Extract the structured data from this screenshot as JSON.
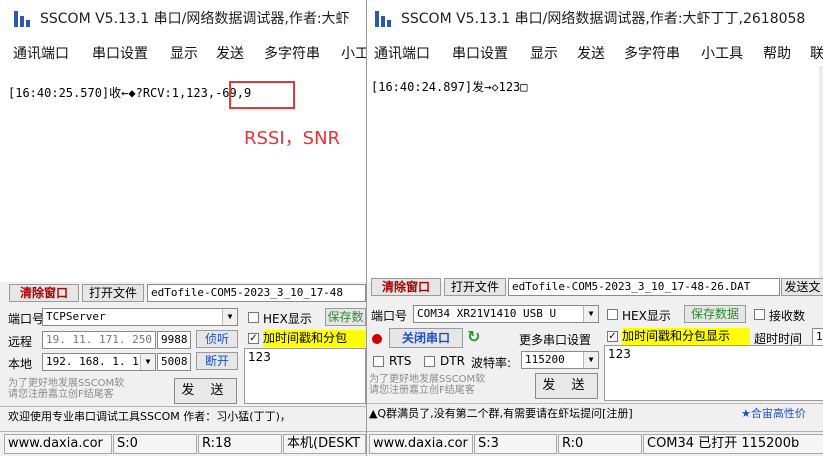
{
  "left_window": {
    "title": "SSCOM V5.13.1 串口/网络数据调试器,作者:大虾",
    "menu": [
      "通讯端口",
      "串口设置",
      "显示",
      "发送",
      "多字符串",
      "小工"
    ],
    "receive_line": "[16:40:25.570]收←◆?RCV:1,123,-69,9",
    "annotation": "RSSI，SNR",
    "clear_button": "清除窗口",
    "open_file_button": "打开文件",
    "file_path": "edTofile-COM5-2023_3_10_17-48",
    "port_label": "端口号",
    "port_value": "TCPServer",
    "hex_display": "HEX显示",
    "save_data": "保存数",
    "timestamp_label": "加时间戳和分包",
    "remote_label": "远程",
    "remote_ip": "19. 11. 171. 250",
    "remote_port": "9988",
    "listen_button": "侦听",
    "local_label": "本地",
    "local_ip": "192. 168. 1. 1",
    "local_port": "5008",
    "disconnect_button": "断开",
    "send_text": "123",
    "promo_line1": "为了更好地发展SSCOM软",
    "promo_line2": "请您注册嘉立创F结尾客",
    "send_button": "发 送",
    "tip": "欢迎使用专业串口调试工具SSCOM  作者：习小猛(丁丁)，",
    "status": {
      "site": "www.daxia.cor",
      "sent": "S:0",
      "received": "R:18",
      "local": "本机(DESKT"
    }
  },
  "right_window": {
    "title": "SSCOM V5.13.1 串口/网络数据调试器,作者:大虾丁丁,2618058",
    "menu": [
      "通讯端口",
      "串口设置",
      "显示",
      "发送",
      "多字符串",
      "小工具",
      "帮助",
      "联"
    ],
    "send_echo": "[16:40:24.897]发→◇123□",
    "clear_button": "清除窗口",
    "open_file_button": "打开文件",
    "file_path": "edTofile-COM5-2023_3_10_17-48-26.DAT",
    "send_file_button": "发送文",
    "port_label": "端口号",
    "port_value": "COM34 XR21V1410 USB U",
    "hex_display": "HEX显示",
    "save_data": "保存数据",
    "receive_file": "接收数",
    "close_port_button": "关闭串口",
    "more_settings": "更多串口设置",
    "timestamp_label": "加时间戳和分包显示",
    "timeout_label": "超时时间",
    "timeout_value": "1",
    "rts_label": "RTS",
    "dtr_label": "DTR",
    "baud_label": "波特率:",
    "baud_value": "115200",
    "send_text": "123",
    "promo_line1": "为了更好地发展SSCOM软",
    "promo_line2": "请您注册嘉立创F结尾客",
    "send_button": "发 送",
    "tip_left": "▲Q群满员了,没有第二个群,有需要请在虾坛提问[注册]",
    "tip_right": "★合宙高性价",
    "status": {
      "site": "www.daxia.cor",
      "sent": "S:3",
      "received": "R:0",
      "port_state": "COM34 已打开  115200b"
    }
  },
  "colors": {
    "annotation_red": "#e23a3a",
    "highlight_yellow": "#ffff00",
    "accent_blue": "#1a4fd0"
  }
}
